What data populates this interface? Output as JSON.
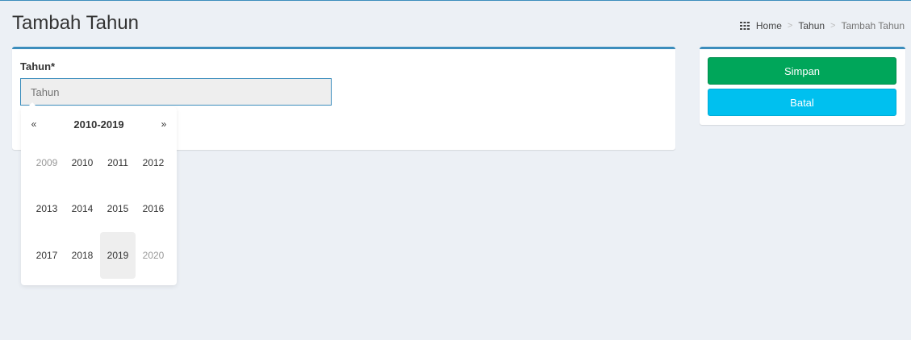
{
  "header": {
    "title": "Tambah Tahun",
    "breadcrumb": [
      {
        "label": "Home",
        "active": false
      },
      {
        "label": "Tahun",
        "active": false
      },
      {
        "label": "Tambah Tahun",
        "active": true
      }
    ],
    "breadcrumb_separator": ">"
  },
  "form": {
    "tahun_label": "Tahun*",
    "tahun_value": "",
    "tahun_placeholder": "Tahun"
  },
  "actions": {
    "save_label": "Simpan",
    "cancel_label": "Batal",
    "save_color": "#00a65a",
    "cancel_color": "#00c0ef"
  },
  "datepicker": {
    "prev_label": "«",
    "next_label": "»",
    "range_title": "2010-2019",
    "years": [
      {
        "label": "2009",
        "state": "muted"
      },
      {
        "label": "2010",
        "state": "normal"
      },
      {
        "label": "2011",
        "state": "normal"
      },
      {
        "label": "2012",
        "state": "normal"
      },
      {
        "label": "2013",
        "state": "normal"
      },
      {
        "label": "2014",
        "state": "normal"
      },
      {
        "label": "2015",
        "state": "normal"
      },
      {
        "label": "2016",
        "state": "normal"
      },
      {
        "label": "2017",
        "state": "normal"
      },
      {
        "label": "2018",
        "state": "normal"
      },
      {
        "label": "2019",
        "state": "active"
      },
      {
        "label": "2020",
        "state": "muted"
      }
    ]
  },
  "icons": {
    "breadcrumb_home": "grid-icon"
  },
  "colors": {
    "accent": "#3c8dbc",
    "background": "#ecf0f5"
  }
}
